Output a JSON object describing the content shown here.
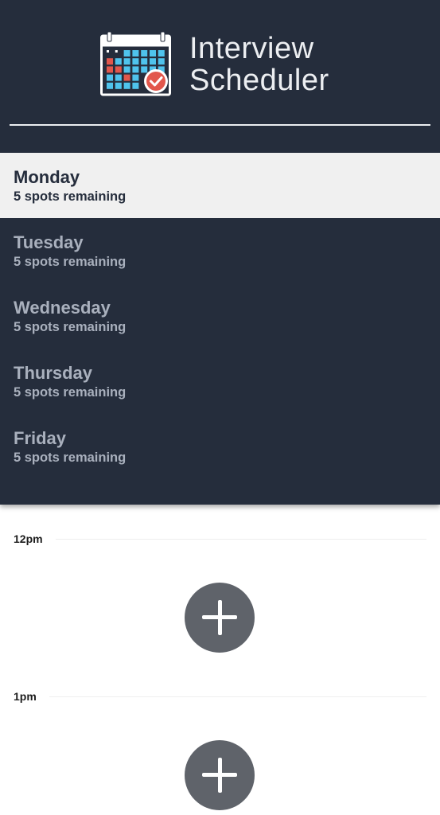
{
  "app": {
    "title_line1": "Interview",
    "title_line2": "Scheduler",
    "logo_icon": "calendar-check-icon"
  },
  "colors": {
    "sidebar_bg": "#252d3c",
    "selected_bg": "#f0f0f0",
    "inactive_text": "#a9b0bd",
    "add_button_bg": "#5f636a",
    "accent_red": "#e2574c",
    "accent_blue": "#4fc3ec"
  },
  "days": [
    {
      "name": "Monday",
      "spots": "5 spots remaining",
      "selected": true
    },
    {
      "name": "Tuesday",
      "spots": "5 spots remaining",
      "selected": false
    },
    {
      "name": "Wednesday",
      "spots": "5 spots remaining",
      "selected": false
    },
    {
      "name": "Thursday",
      "spots": "5 spots remaining",
      "selected": false
    },
    {
      "name": "Friday",
      "spots": "5 spots remaining",
      "selected": false
    }
  ],
  "schedule": {
    "slots": [
      {
        "time": "12pm",
        "action_icon": "plus-icon"
      },
      {
        "time": "1pm",
        "action_icon": "plus-icon"
      }
    ]
  }
}
